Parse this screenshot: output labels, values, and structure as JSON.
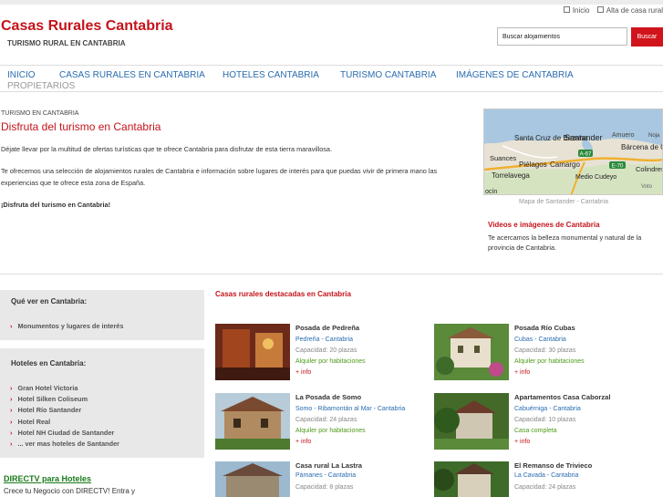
{
  "top_links": [
    "Inicio",
    "Alta de casa rural"
  ],
  "site": {
    "title": "Casas Rurales Cantabria",
    "tagline": "TURISMO RURAL EN CANTABRIA"
  },
  "search": {
    "value": "Buscar alojamientos",
    "button": "Buscar"
  },
  "nav": [
    "INICIO",
    "CASAS RURALES EN CANTABRIA",
    "HOTELES CANTABRIA",
    "TURISMO CANTABRIA",
    "IMÁGENES DE CANTABRIA",
    "PROPIETARIOS"
  ],
  "main": {
    "breadcrumb": "TURISMO EN CANTABRIA",
    "title": "Disfruta del turismo en Cantabria",
    "p1": "Déjate llevar por la multitud de ofertas turísticas que te ofrece Cantabria para disfrutar de esta tierra maravillosa.",
    "p2": "Te ofrecemos una selección de alojamientos rurales de Cantabria e información sobre lugares de interés para que puedas vivir de primera mano las experiencias que te ofrece esta zona de España.",
    "p3": "¡Disfruta del turismo en Cantabria!"
  },
  "map": {
    "labels": [
      "Santa Cruz de Bezana",
      "Santander",
      "Amuero",
      "Noja",
      "Bárcena de Cicero",
      "Suances",
      "Piélagos",
      "Camargo",
      "E-70",
      "A-67",
      "Colindres",
      "Torrelavega",
      "Medio Cudeyo",
      "Voto",
      "ocín"
    ],
    "caption": "Mapa de Santander - Cantabria"
  },
  "videos": {
    "title": "Videos e imágenes de Cantabria",
    "text": "Te acercamos la belleza monumental y natural de la provincia de Cantabria."
  },
  "sidebar": {
    "que_ver": {
      "heading": "Qué ver en Cantabria:",
      "items": [
        "Monumentos y lugares de interés"
      ]
    },
    "hoteles": {
      "heading": "Hoteles en Cantabria:",
      "items": [
        "Gran Hotel Victoria",
        "Hotel Silken Coliseum",
        "Hotel Río Santander",
        "Hotel Real",
        "Hotel NH Ciudad de Santander",
        "... ver mas hoteles de Santander"
      ]
    },
    "directv": {
      "link": "DIRECTV para Hoteles",
      "text": "Crece tu Negocio con DIRECTV! Entra y"
    }
  },
  "featured": {
    "title": "Casas rurales destacadas en Cantabria",
    "cards": [
      {
        "name": "Posada de Pedreña",
        "location": "Pedreña - Cantabria",
        "capacity": "Capacidad: 20 plazas",
        "type": "Alquiler por habitaciones",
        "more": "+ info"
      },
      {
        "name": "Posada Río Cubas",
        "location": "Cubas - Cantabria",
        "capacity": "Capacidad: 30 plazas",
        "type": "Alquiler por habitaciones",
        "more": "+ info"
      },
      {
        "name": "La Posada de Somo",
        "location": "Somo - Ribamontán al Mar - Cantabria",
        "capacity": "Capacidad: 24 plazas",
        "type": "Alquiler por habitaciones",
        "more": "+ info"
      },
      {
        "name": "Apartamentos Casa Caborzal",
        "location": "Cabuérniga - Cantabria",
        "capacity": "Capacidad: 10 plazas",
        "type": "Casa completa",
        "more": "+ info"
      },
      {
        "name": "Casa rural La Lastra",
        "location": "Pámanes - Cantabria",
        "capacity": "Capacidad: 8 plazas",
        "type": "",
        "more": ""
      },
      {
        "name": "El Remanso de Trivieco",
        "location": "La Cavada - Cantabria",
        "capacity": "Capacidad: 24 plazas",
        "type": "",
        "more": ""
      }
    ]
  }
}
